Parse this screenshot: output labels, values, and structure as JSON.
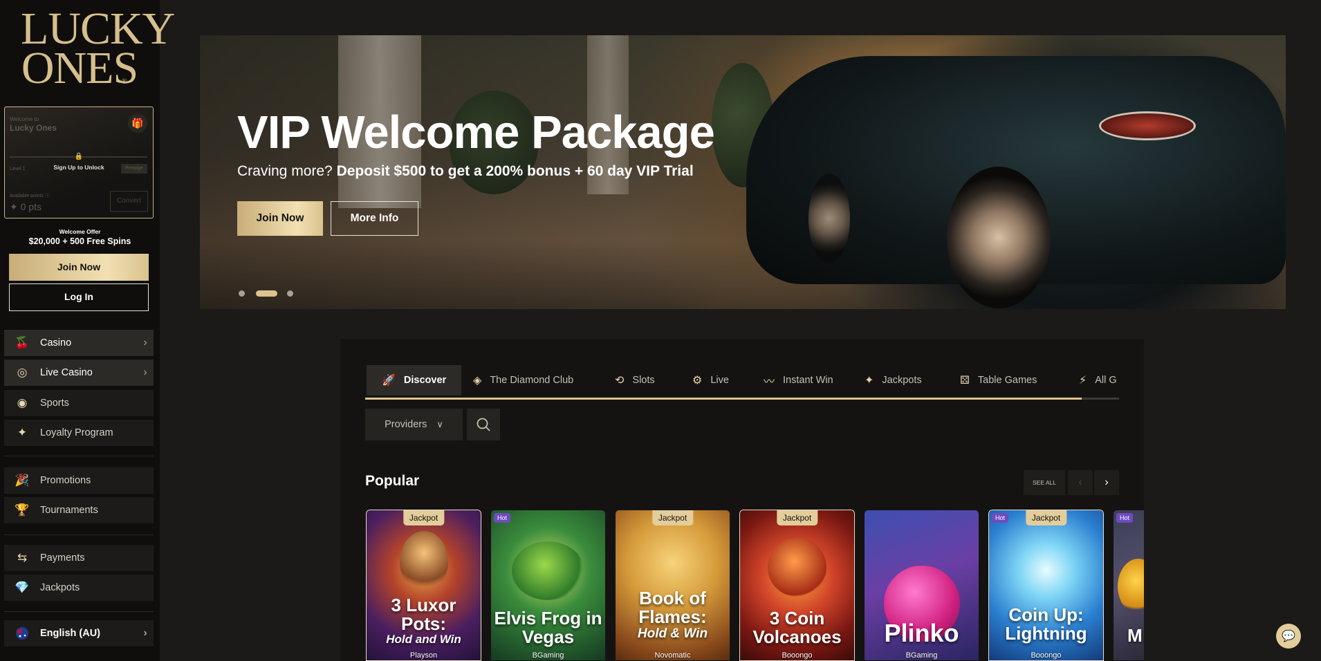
{
  "brand": {
    "line1": "LUCKY",
    "line2": "ONES",
    "reg": "®"
  },
  "loyalty_card": {
    "welcome": "Welcome to",
    "name": "Lucky Ones",
    "lock_icon": "lock-icon",
    "unlock": "Sign Up to Unlock",
    "level": "Level 1",
    "level_badge": "Prestige",
    "available": "Available points ⓘ",
    "points": "✦ 0 pts",
    "convert": "Convert"
  },
  "welcome_offer": {
    "label": "Welcome Offer",
    "amount": "$20,000 + 500 Free Spins"
  },
  "sidebar_buttons": {
    "join": "Join Now",
    "login": "Log In"
  },
  "nav": {
    "casino": "Casino",
    "live_casino": "Live Casino",
    "sports": "Sports",
    "loyalty": "Loyalty Program",
    "promotions": "Promotions",
    "tournaments": "Tournaments",
    "payments": "Payments",
    "jackpots": "Jackpots",
    "language": "English (AU)"
  },
  "hero": {
    "title": "VIP Welcome Package",
    "sub_plain": "Craving more?",
    "sub_bold": "Deposit $500 to get a 200% bonus + 60 day VIP Trial",
    "join": "Join Now",
    "more": "More Info",
    "active_slide": 2,
    "slide_count": 3
  },
  "tabs": [
    {
      "label": "Discover",
      "icon": "rocket-icon",
      "active": true
    },
    {
      "label": "The Diamond Club",
      "icon": "diamond-icon"
    },
    {
      "label": "Slots",
      "icon": "slots-icon"
    },
    {
      "label": "Live",
      "icon": "live-icon"
    },
    {
      "label": "Instant Win",
      "icon": "trend-icon"
    },
    {
      "label": "Jackpots",
      "icon": "sparkle-icon"
    },
    {
      "label": "Table Games",
      "icon": "dice-icon"
    },
    {
      "label": "All G",
      "icon": "bolt-icon"
    }
  ],
  "tab_scroll_progress": 0.95,
  "filters": {
    "providers": "Providers"
  },
  "section": {
    "title": "Popular",
    "see_all": "SEE ALL"
  },
  "games": [
    {
      "title": "3 Luxor Pots:",
      "subtitle": "Hold and Win",
      "provider": "Playson",
      "badge": "Jackpot"
    },
    {
      "title": "Elvis Frog in Vegas",
      "subtitle": "",
      "provider": "BGaming",
      "badge": "Hot"
    },
    {
      "title": "Book of Flames:",
      "subtitle": "Hold & Win",
      "provider": "Novomatic",
      "badge": "Jackpot"
    },
    {
      "title": "3 Coin Volcanoes",
      "subtitle": "",
      "provider": "Booongo",
      "badge": "Jackpot"
    },
    {
      "title": "Plinko",
      "subtitle": "",
      "provider": "BGaming",
      "badge": ""
    },
    {
      "title": "Coin Up: Lightning",
      "subtitle": "",
      "provider": "Booongo",
      "badge": "Jackpot",
      "badge2": "Hot"
    },
    {
      "title": "M",
      "subtitle": "",
      "provider": "",
      "badge": "Hot"
    }
  ],
  "colors": {
    "gold": "#dcc48f",
    "bg": "#1b1a18",
    "sidebar": "#0f0e0d",
    "panel": "#141311"
  }
}
